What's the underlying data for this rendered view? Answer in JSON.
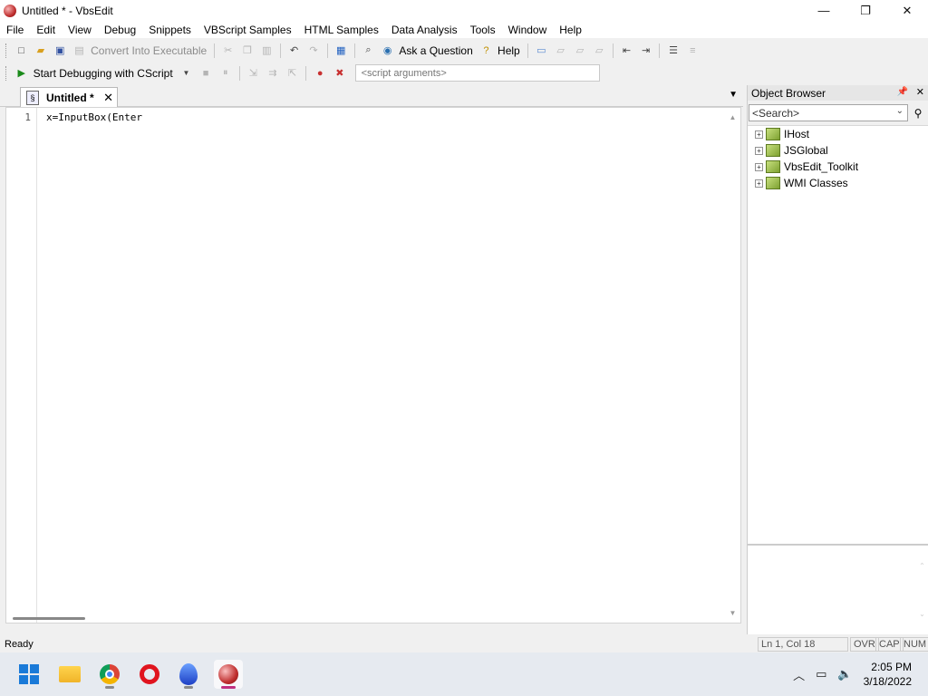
{
  "window": {
    "title": "Untitled * - VbsEdit",
    "controls": {
      "minimize": "—",
      "maximize": "❐",
      "close": "✕"
    }
  },
  "menu": [
    "File",
    "Edit",
    "View",
    "Debug",
    "Snippets",
    "VBScript Samples",
    "HTML Samples",
    "Data Analysis",
    "Tools",
    "Window",
    "Help"
  ],
  "toolbar": {
    "convert_label": "Convert Into Executable",
    "ask_label": "Ask a Question",
    "help_label": "Help",
    "debug_label": "Start Debugging with CScript",
    "script_args_placeholder": "<script arguments>"
  },
  "editor": {
    "tab_label": "Untitled *",
    "tab_close": "✕",
    "line_number": "1",
    "code": "x=InputBox(Enter"
  },
  "object_browser": {
    "title": "Object Browser",
    "search_placeholder": "<Search>",
    "items": [
      "IHost",
      "JSGlobal",
      "VbsEdit_Toolkit",
      "WMI Classes"
    ]
  },
  "status": {
    "ready": "Ready",
    "position": "Ln 1, Col 18",
    "ovr": "OVR",
    "cap": "CAP",
    "num": "NUM"
  },
  "taskbar": {
    "time": "2:05 PM",
    "date": "3/18/2022"
  }
}
